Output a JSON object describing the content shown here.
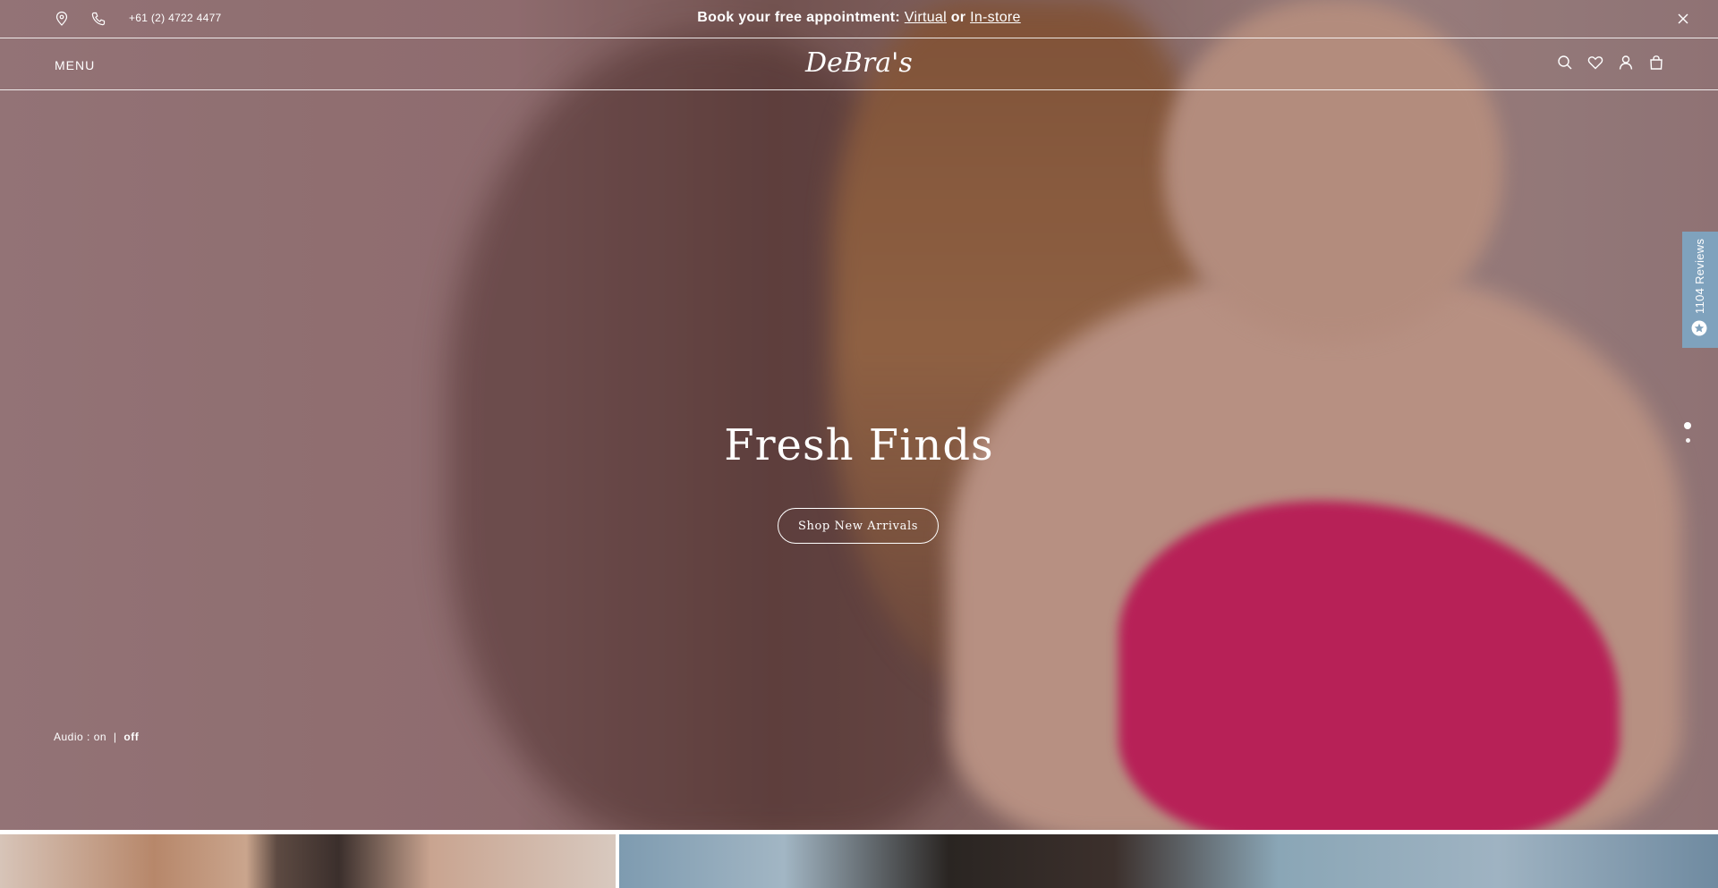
{
  "topbar": {
    "phone": "+61 (2) 4722 4477",
    "announcement_prefix": "Book your free appointment:",
    "announcement_link_virtual": "Virtual",
    "announcement_or": "or",
    "announcement_link_instore": "In-store"
  },
  "header": {
    "menu_label": "MENU",
    "logo_text": "DeBra's"
  },
  "hero": {
    "title": "Fresh Finds",
    "cta_label": "Shop New Arrivals",
    "audio_label": "Audio :",
    "audio_on": "on",
    "audio_separator": "|",
    "audio_off": "off"
  },
  "reviews_tab": {
    "label": "1104 Reviews"
  },
  "slider": {
    "total_slides": 2,
    "active_slide": 1
  },
  "colors": {
    "reviews_tab": "#7fa2bd",
    "text_on_hero": "#ffffff",
    "garment_accent": "#c9215f"
  },
  "icons": {
    "location": "location-pin-icon",
    "phone": "phone-icon",
    "close": "close-icon",
    "search": "search-icon",
    "wishlist": "heart-icon",
    "account": "user-icon",
    "cart": "shopping-bag-icon",
    "reviews": "star-badge-icon"
  }
}
